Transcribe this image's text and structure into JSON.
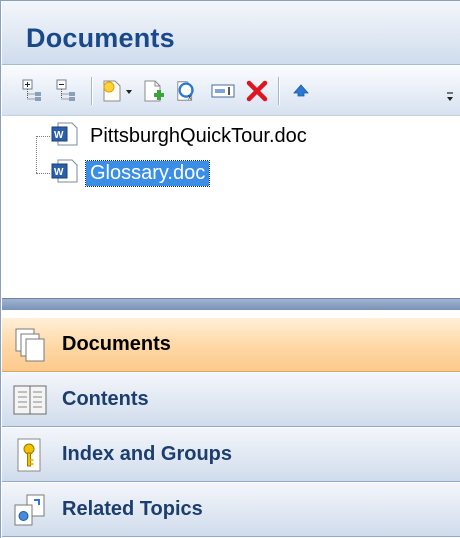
{
  "header": {
    "title": "Documents"
  },
  "toolbar": {
    "buttons": [
      {
        "name": "expand-all-icon"
      },
      {
        "name": "collapse-all-icon"
      },
      {
        "name": "new-document-dropdown-icon"
      },
      {
        "name": "add-document-icon"
      },
      {
        "name": "replace-document-icon"
      },
      {
        "name": "rename-icon"
      },
      {
        "name": "delete-icon"
      },
      {
        "name": "move-up-icon"
      }
    ],
    "colors": {
      "delete": "#e0141e",
      "add": "#3aa53a",
      "arrow": "#2a78d4"
    }
  },
  "tree": {
    "items": [
      {
        "label": "PittsburghQuickTour.doc",
        "selected": false,
        "icon": "word-document-icon"
      },
      {
        "label": "Glossary.doc",
        "selected": true,
        "icon": "word-document-icon"
      }
    ]
  },
  "nav": {
    "items": [
      {
        "label": "Documents",
        "icon": "documents-icon",
        "active": true
      },
      {
        "label": "Contents",
        "icon": "contents-book-icon",
        "active": false
      },
      {
        "label": "Index and Groups",
        "icon": "key-icon",
        "active": false
      },
      {
        "label": "Related Topics",
        "icon": "related-topics-icon",
        "active": false
      }
    ]
  },
  "colors": {
    "header_text": "#19498a",
    "selection": "#3a8ee6",
    "active_nav": "#ffd9a8"
  }
}
